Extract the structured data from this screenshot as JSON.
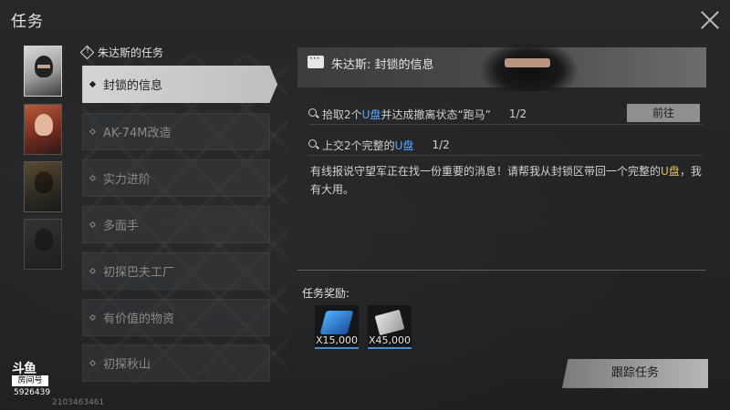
{
  "header": {
    "title": "任务"
  },
  "giver": {
    "name": "朱达斯的任务"
  },
  "quests": [
    {
      "label": "封锁的信息",
      "active": true
    },
    {
      "label": "AK-74M改造",
      "active": false
    },
    {
      "label": "实力进阶",
      "active": false
    },
    {
      "label": "多面手",
      "active": false
    },
    {
      "label": "初探巴夫工厂",
      "active": false
    },
    {
      "label": "有价值的物资",
      "active": false
    },
    {
      "label": "初探秋山",
      "active": false
    }
  ],
  "detail": {
    "title": "朱达斯: 封锁的信息",
    "objectives": [
      {
        "pre": "拾取2个",
        "item": "U盘",
        "post": "并达成撤离状态“跑马”",
        "progress": "1/2"
      },
      {
        "pre": "上交2个完整的",
        "item": "U盘",
        "post": "",
        "progress": "1/2"
      }
    ],
    "goto_label": "前往",
    "desc_part1": "有线报说守望军正在找一份重要的消息！请帮我从封锁区带回一个完整的",
    "desc_item": "U盘",
    "desc_part2": "，我有大用。",
    "reward_label": "任务奖励:",
    "rewards": [
      {
        "qty": "X15,000",
        "icon": "crystal-currency-icon"
      },
      {
        "qty": "X45,000",
        "icon": "cash-bundle-icon"
      }
    ],
    "track_label": "跟踪任务"
  },
  "watermark": {
    "brand": "斗鱼",
    "room_label": "房间号",
    "room_number": "5926439",
    "uid": "2103463461"
  },
  "colors": {
    "highlight": "#58a9ff",
    "item_yellow": "#e8c34a",
    "reward_border": "#3d8fd6"
  }
}
